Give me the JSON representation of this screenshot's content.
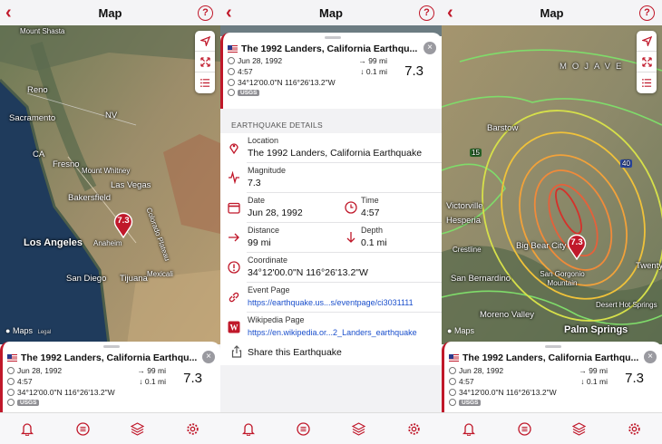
{
  "colors": {
    "accent": "#c0182a",
    "link": "#1a4fcc"
  },
  "nav": {
    "back_icon": "‹",
    "title": "Map",
    "help_icon": "?"
  },
  "earthquake": {
    "title": "The 1992 Landers, California Earthqu...",
    "date": "Jun 28, 1992",
    "time": "4:57",
    "coordinate": "34°12'00.0\"N 116°26'13.2\"W",
    "source": "USGS",
    "distance": "99 mi",
    "depth": "0.1 mi",
    "magnitude": "7.3",
    "pin_label": "7.3"
  },
  "map_attribution": {
    "brand": "Maps",
    "legal": "Legal"
  },
  "map1": {
    "labels": [
      {
        "text": "Mount Shasta",
        "cls": "sm"
      },
      {
        "text": "Reno",
        "cls": ""
      },
      {
        "text": "Sacramento",
        "cls": ""
      },
      {
        "text": "NV",
        "cls": ""
      },
      {
        "text": "CA",
        "cls": ""
      },
      {
        "text": "Fresno",
        "cls": ""
      },
      {
        "text": "Mount Whitney",
        "cls": "sm"
      },
      {
        "text": "Las Vegas",
        "cls": ""
      },
      {
        "text": "Bakersfield",
        "cls": ""
      },
      {
        "text": "Los Angeles",
        "cls": "big"
      },
      {
        "text": "Anaheim",
        "cls": "sm"
      },
      {
        "text": "San Diego",
        "cls": ""
      },
      {
        "text": "Tijuana",
        "cls": ""
      },
      {
        "text": "Mexicali",
        "cls": "sm"
      },
      {
        "text": "Colorado Plateau",
        "cls": "sm"
      }
    ]
  },
  "map3": {
    "labels": [
      {
        "text": "Barstow",
        "cls": ""
      },
      {
        "text": "MOJAVE",
        "cls": ""
      },
      {
        "text": "Victorville",
        "cls": ""
      },
      {
        "text": "Hesperia",
        "cls": ""
      },
      {
        "text": "Big Bear City",
        "cls": ""
      },
      {
        "text": "Crestline",
        "cls": "sm"
      },
      {
        "text": "San Bernardino",
        "cls": ""
      },
      {
        "text": "San Gorgonio Mountain",
        "cls": "sm"
      },
      {
        "text": "Desert Hot Springs",
        "cls": "sm"
      },
      {
        "text": "Moreno Valley",
        "cls": ""
      },
      {
        "text": "Palm Springs",
        "cls": "big"
      },
      {
        "text": "Twenty",
        "cls": ""
      },
      {
        "text": "15",
        "cls": "sm"
      },
      {
        "text": "40",
        "cls": "sm"
      }
    ]
  },
  "details": {
    "section_header": "EARTHQUAKE DETAILS",
    "location_label": "Location",
    "location_value": "The 1992 Landers, California Earthquake",
    "magnitude_label": "Magnitude",
    "magnitude_value": "7.3",
    "date_label": "Date",
    "date_value": "Jun 28, 1992",
    "time_label": "Time",
    "time_value": "4:57",
    "distance_label": "Distance",
    "distance_value": "99 mi",
    "depth_label": "Depth",
    "depth_value": "0.1 mi",
    "coordinate_label": "Coordinate",
    "coordinate_value": "34°12'00.0\"N 116°26'13.2\"W",
    "event_label": "Event Page",
    "event_value": "https://earthquake.us...s/eventpage/ci3031111",
    "wiki_label": "Wikipedia Page",
    "wiki_value": "https://en.wikipedia.or...2_Landers_earthquake",
    "share_label": "Share this Earthquake"
  },
  "tabs": [
    "bell-icon",
    "list-icon",
    "layers-icon",
    "gear-icon"
  ]
}
